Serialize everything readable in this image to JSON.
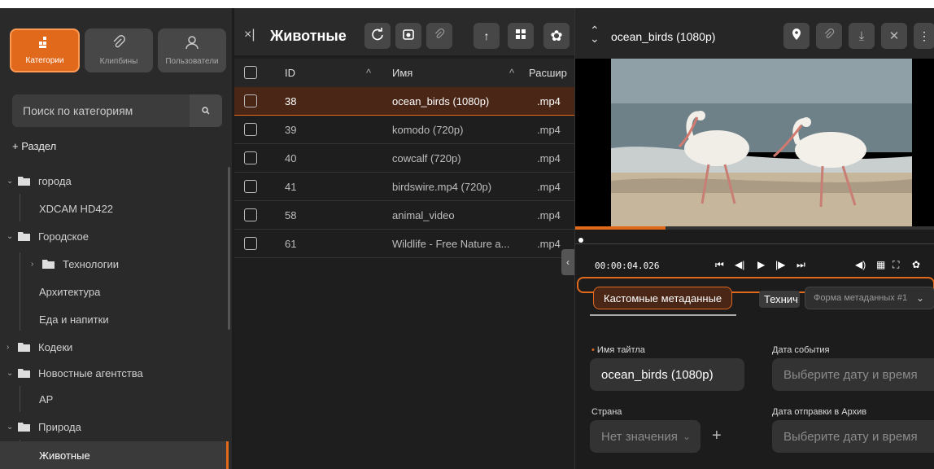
{
  "sidebar": {
    "tabs": [
      {
        "label": "Категории",
        "icon": "categories-icon"
      },
      {
        "label": "Клипбины",
        "icon": "paperclip-icon"
      },
      {
        "label": "Пользователи",
        "icon": "user-icon"
      }
    ],
    "search_placeholder": "Поиск по категориям",
    "add_section": "+ Раздел",
    "tree": [
      {
        "label": "города",
        "type": "folder-open",
        "chev": "⌄"
      },
      {
        "label": "XDCAM HD422",
        "type": "leaf"
      },
      {
        "label": "Городское",
        "type": "folder-open",
        "chev": "⌄"
      },
      {
        "label": "Технологии",
        "type": "folder",
        "chev": "›"
      },
      {
        "label": "Архитектура",
        "type": "leaf"
      },
      {
        "label": "Еда и напитки",
        "type": "leaf"
      },
      {
        "label": "Кодеки",
        "type": "folder",
        "chev": "›"
      },
      {
        "label": "Новостные агентства",
        "type": "folder-open",
        "chev": "⌄"
      },
      {
        "label": "AP",
        "type": "leaf"
      },
      {
        "label": "Природа",
        "type": "folder-open",
        "chev": "⌄"
      },
      {
        "label": "Животные",
        "type": "leaf-selected"
      }
    ]
  },
  "middle": {
    "title": "Животные",
    "columns": [
      "ID",
      "Имя",
      "Расшир"
    ],
    "rows": [
      {
        "id": "38",
        "name": "ocean_birds (1080p)",
        "ext": ".mp4"
      },
      {
        "id": "39",
        "name": "komodo (720p)",
        "ext": ".mp4"
      },
      {
        "id": "40",
        "name": "cowcalf (720p)",
        "ext": ".mp4"
      },
      {
        "id": "41",
        "name": "birdswire.mp4 (720p)",
        "ext": ".mp4"
      },
      {
        "id": "58",
        "name": "animal_video",
        "ext": ".mp4"
      },
      {
        "id": "61",
        "name": "Wildlife - Free Nature a...",
        "ext": ".mp4"
      }
    ]
  },
  "right": {
    "title": "ocean_birds (1080p)",
    "timecode": "00:00:04.026",
    "progress_fraction": 0.25,
    "tab_custom": "Кастомные метаданные",
    "tab_tech": "Технич",
    "form_select": "Форма метаданных #1",
    "fields": {
      "title_label": "Имя тайтла",
      "title_value": "ocean_birds (1080p)",
      "event_date_label": "Дата события",
      "event_date_placeholder": "Выберите дату и время",
      "country_label": "Страна",
      "country_placeholder": "Нет значения",
      "archive_date_label": "Дата отправки в Архив",
      "archive_date_placeholder": "Выберите дату и время"
    }
  },
  "colors": {
    "accent": "#e0691c",
    "selected_row": "#4a2617"
  }
}
